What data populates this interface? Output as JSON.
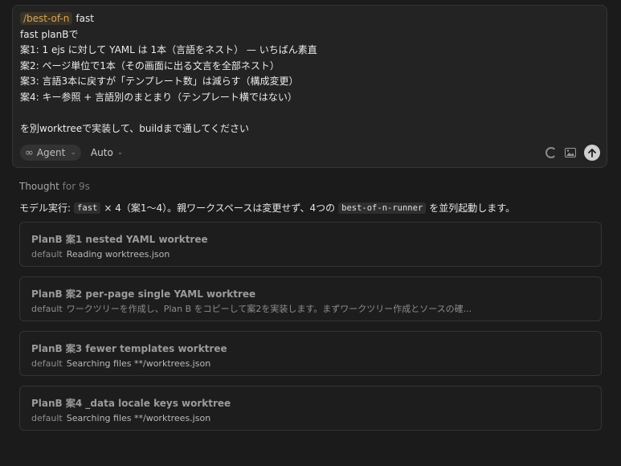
{
  "composer": {
    "command_chip": "/best-of-n",
    "command_arg": "fast",
    "lines": [
      "fast planBで",
      "案1: 1 ejs に対して YAML は 1本（言語をネスト） — いちばん素直",
      "案2: ページ単位で1本（その画面に出る文言を全部ネスト）",
      "案3: 言語3本に戻すが「テンプレート数」は減らす（構成変更）",
      "案4: キー参照 + 言語別のまとまり（テンプレート横ではない）",
      "",
      "を別worktreeで実装して、buildまで通してください"
    ],
    "agent_label": "Agent",
    "agent_icon": "infinity-icon",
    "mode_label": "Auto"
  },
  "thought": {
    "label": "Thought",
    "duration": "for 9s"
  },
  "exec": {
    "prefix": "モデル実行:",
    "model": "fast",
    "middle": "× 4（案1〜4）。親ワークスペースは変更せず、4つの",
    "runner": "best-of-n-runner",
    "suffix": "を並列起動します。"
  },
  "tasks": [
    {
      "title": "PlanB 案1 nested YAML worktree",
      "label": "default",
      "status": "Reading worktrees.json",
      "dim": false
    },
    {
      "title": "PlanB 案2 per-page single YAML worktree",
      "label": "default",
      "status": "ワークツリーを作成し、Plan B をコピーして案2を実装します。まずワークツリー作成とソースの確...",
      "dim": true
    },
    {
      "title": "PlanB 案3 fewer templates worktree",
      "label": "default",
      "status": "Searching files **/worktrees.json",
      "dim": false
    },
    {
      "title": "PlanB 案4 _data locale keys worktree",
      "label": "default",
      "status": "Searching files **/worktrees.json",
      "dim": false
    }
  ]
}
